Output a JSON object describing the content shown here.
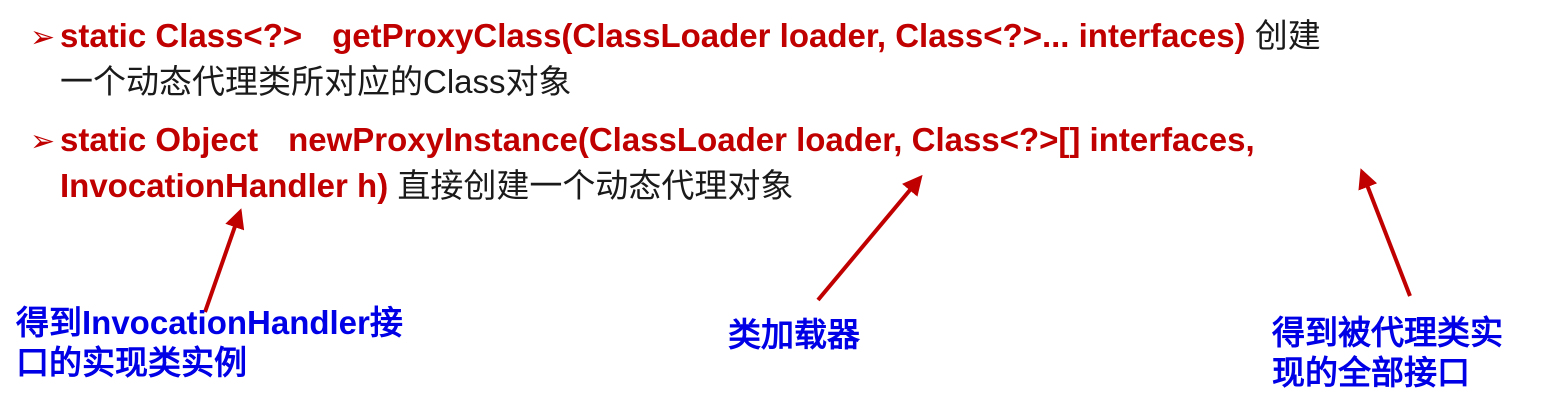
{
  "bullets": [
    {
      "marker": "➢",
      "modifier": "static Class<?>",
      "signature": "getProxyClass(ClassLoader loader, Class<?>... interfaces)",
      "desc_line1": "创建",
      "desc_line2_a": "一个动态代理类所对应的",
      "desc_line2_b": "Class",
      "desc_line2_c": "对象"
    },
    {
      "marker": "➢",
      "modifier": "static Object",
      "signature": "newProxyInstance(ClassLoader loader, Class<?>[] interfaces,",
      "signature_cont": "InvocationHandler h)",
      "desc": "直接创建一个动态代理对象"
    }
  ],
  "annotations": {
    "handler": {
      "line1": "得到InvocationHandler接",
      "line2": "口的实现类实例"
    },
    "loader": {
      "line1": "类加载器"
    },
    "interfaces": {
      "line1": "得到被代理类实",
      "line2": "现的全部接口"
    }
  },
  "colors": {
    "code": "#C00000",
    "annotation": "#0000E6",
    "arrow": "#C00000"
  }
}
